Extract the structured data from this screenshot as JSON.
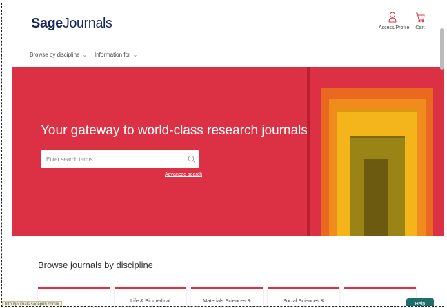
{
  "header": {
    "logo_bold": "Sage",
    "logo_rest": "Journals",
    "access_label": "Access/Profile",
    "cart_label": "Cart"
  },
  "nav": {
    "items": [
      {
        "label": "Browse by discipline"
      },
      {
        "label": "Information for"
      }
    ]
  },
  "hero": {
    "title": "Your gateway to world-class research journals",
    "search_placeholder": "Enter search terms...",
    "advanced_search": "Advanced search",
    "art_colors": [
      "#e8691f",
      "#f08b1e",
      "#f3b51a",
      "#9a8416",
      "#6b5a10"
    ]
  },
  "browse": {
    "title": "Browse journals by discipline",
    "cards": [
      {
        "label": ""
      },
      {
        "label": "Life & Biomedical"
      },
      {
        "label": "Materials Sciences &"
      },
      {
        "label": "Social Sciences &"
      },
      {
        "label": ""
      }
    ]
  },
  "statusbar": {
    "url": "http://journals.sagepub.com/#"
  },
  "help": {
    "label": "Help"
  },
  "colors": {
    "brand_red": "#dc3044",
    "logo_navy": "#1a2a5e"
  }
}
